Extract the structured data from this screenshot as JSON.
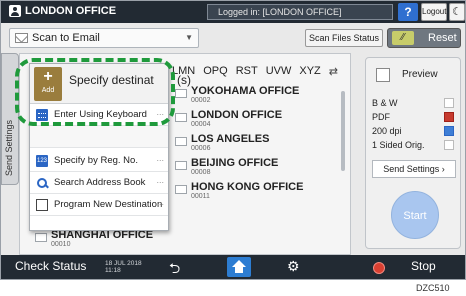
{
  "header": {
    "office_title": "LONDON OFFICE",
    "login_text": "Logged in: [LONDON OFFICE]",
    "help_label": "?",
    "logout_label": "Logout",
    "moon_label": "☾"
  },
  "toolbar": {
    "scan_mode": "Scan to Email",
    "scan_files_status": "Scan Files Status",
    "reset_label": "Reset",
    "reset_icon": "⁄⁄"
  },
  "left_tab": {
    "label": "Send Settings"
  },
  "alpha_tabs": [
    "LMN",
    "OPQ",
    "RST",
    "UVW",
    "XYZ"
  ],
  "popup": {
    "add_plus": "+",
    "add_label": "Add",
    "title_left": "Specify destinat",
    "title_right": "(s)",
    "items": [
      {
        "label": "Enter Using Keyboard",
        "icon": "keyboard-icon"
      },
      {
        "label": "Specify by Reg. No.",
        "icon": "reg-number-icon"
      },
      {
        "label": "Search Address Book",
        "icon": "search-icon"
      },
      {
        "label": "Program New Destination",
        "icon": "program-icon"
      }
    ],
    "dots": "..."
  },
  "destinations": {
    "right": [
      {
        "name": "YOKOHAMA OFFICE",
        "num": "00002"
      },
      {
        "name": "LONDON OFFICE",
        "num": "00004"
      },
      {
        "name": "LOS ANGELES",
        "num": "00006"
      },
      {
        "name": "BEIJING OFFICE",
        "num": "00008"
      },
      {
        "name": "HONG KONG OFFICE",
        "num": "00011"
      }
    ],
    "left": [
      {
        "name": "SHANGHAI OFFICE",
        "num": "00010"
      }
    ],
    "left_partial_num": "00007"
  },
  "right_panel": {
    "preview_label": "Preview",
    "settings": [
      "B & W",
      "PDF",
      "200 dpi",
      "1 Sided Orig."
    ],
    "send_settings": "Send Settings",
    "send_settings_chevron": "›",
    "start_label": "Start"
  },
  "bottom": {
    "check_status": "Check Status",
    "date": "18 JUL 2018",
    "time": "11:18",
    "back_glyph": "⮌",
    "gear_glyph": "⚙",
    "stop_label": "Stop"
  },
  "corner_code": "DZC510",
  "colors": {
    "accent_blue": "#2d7dd2",
    "highlight_green": "#1f9a3c",
    "add_tile": "#9a7d3d",
    "stop_red": "#d94032"
  }
}
